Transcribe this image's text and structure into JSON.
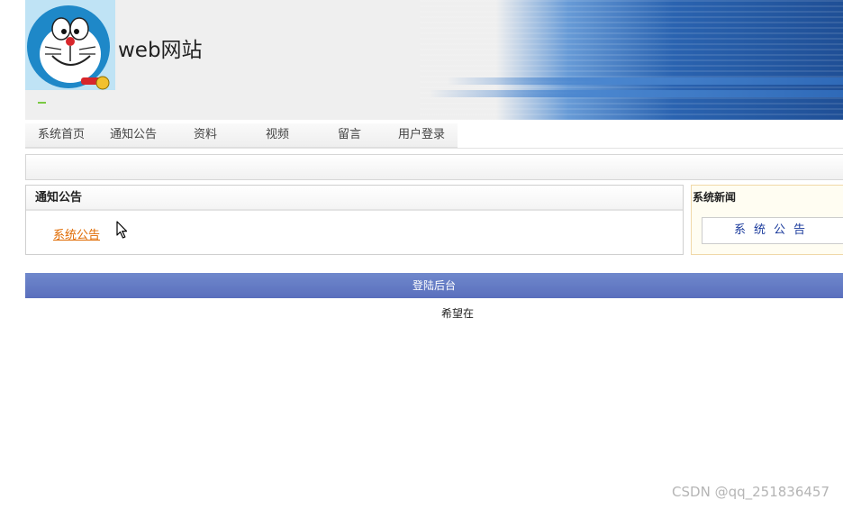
{
  "header": {
    "site_title": "web网站",
    "logo_icon": "doraemon-logo-icon"
  },
  "nav": {
    "items": [
      {
        "label": "系统首页"
      },
      {
        "label": "通知公告"
      },
      {
        "label": "资料"
      },
      {
        "label": "视频"
      },
      {
        "label": "留言"
      },
      {
        "label": "用户登录"
      }
    ]
  },
  "notice_panel": {
    "title": "通知公告",
    "link": "系统公告"
  },
  "news_panel": {
    "title": "系统新闻",
    "item": "系统公告"
  },
  "footer": {
    "bar_label": "登陆后台",
    "text": "希望在"
  },
  "watermark": "CSDN @qq_251836457",
  "colors": {
    "link": "#e06a00",
    "footer_bar": "#5a6fbd",
    "header_blue": "#2a63b0",
    "news_text": "#1a3a9c"
  }
}
